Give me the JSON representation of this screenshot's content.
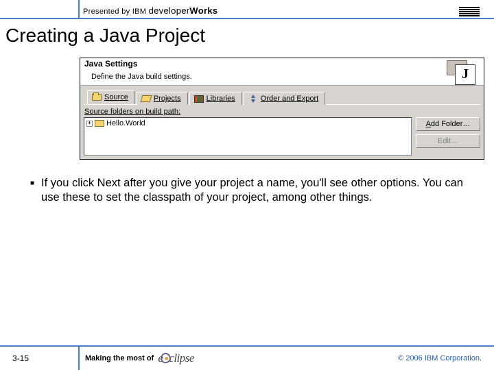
{
  "header": {
    "presented_by": "Presented by IBM ",
    "brand1": "developer",
    "brand2": "Works",
    "ibm": "IBM"
  },
  "title": "Creating a Java Project",
  "dialog": {
    "heading": "Java Settings",
    "sub": "Define the Java build settings.",
    "icon_letter": "J",
    "tabs": {
      "source": "Source",
      "projects": "Projects",
      "libraries": "Libraries",
      "order": "Order and Export"
    },
    "panel_label": "Source folders on build path:",
    "tree_item": "Hello.World",
    "btn_add": "Add Folder…",
    "btn_edit": "Edit…"
  },
  "bullet": "If you click Next after you give your project a name, you'll see other options.  You can use these to set the classpath of your project, among other things.",
  "footer": {
    "page": "3-15",
    "making": "Making the most of",
    "eclipse": "eclipse",
    "copyright": "© 2006 IBM Corporation."
  }
}
